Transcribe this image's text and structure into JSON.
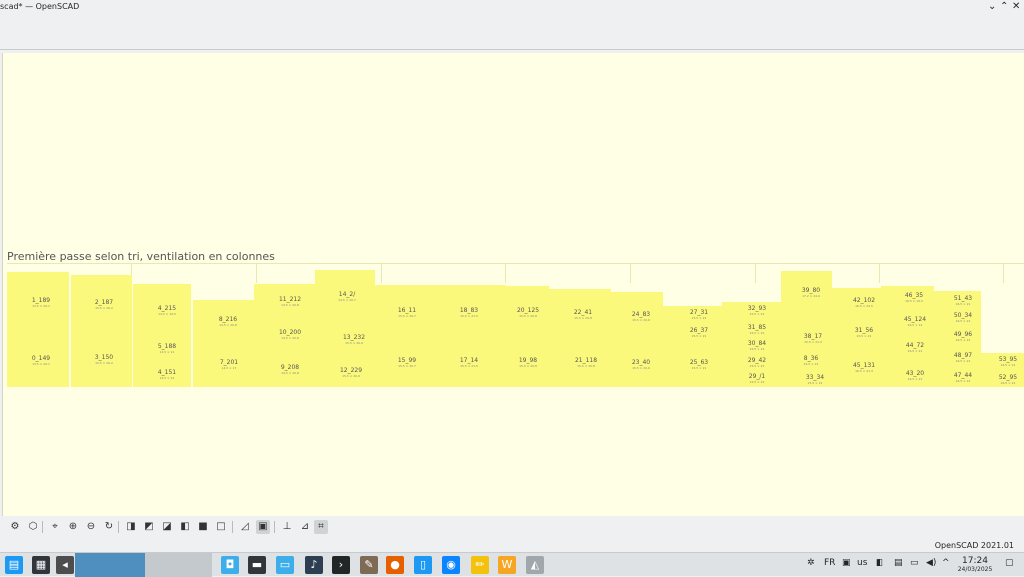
{
  "window": {
    "title": "scad* — OpenSCAD",
    "minimize_icon": "chevron-down-icon",
    "restore_icon": "chevron-up-icon",
    "close_icon": "close-icon"
  },
  "viewport": {
    "background": "#ffffe5",
    "block_color": "#fbf97c",
    "caption": "Première passe selon tri, ventilation en colonnes",
    "labels": [
      {
        "main": "1_189",
        "sub": "13,5 × 20,1"
      },
      {
        "main": "2_187",
        "sub": "15,5 × 20,2"
      },
      {
        "main": "4_215",
        "sub": "14,5 × 16,5"
      },
      {
        "main": "8_216",
        "sub": "14,5 × 20,8"
      },
      {
        "main": "11_212",
        "sub": "14,5 × 20,8"
      },
      {
        "main": "14_2/",
        "sub": "14,5 × 20,7"
      },
      {
        "main": "16_11",
        "sub": "15,5 × 20,7"
      },
      {
        "main": "18_83",
        "sub": "15,5 × 21,5"
      },
      {
        "main": "20_125",
        "sub": "15,5 × 20,8"
      },
      {
        "main": "22_41",
        "sub": "15,5 × 20,8"
      },
      {
        "main": "24_83",
        "sub": "15,5 × 20,6"
      },
      {
        "main": "27_31",
        "sub": "15,5 × 21"
      },
      {
        "main": "32_93",
        "sub": "15,5 × 21"
      },
      {
        "main": "39_80",
        "sub": "17,2 × 24,0"
      },
      {
        "main": "42_102",
        "sub": "16,5 × 24,5"
      },
      {
        "main": "46_35",
        "sub": "16,5 × 19,5"
      },
      {
        "main": "51_43",
        "sub": "16,5 × 21"
      },
      {
        "main": "5_188",
        "sub": "14,5 × 21"
      },
      {
        "main": "10_200",
        "sub": "14,5 × 20,8"
      },
      {
        "main": "13_232",
        "sub": "15,5 × 20,9"
      },
      {
        "main": "26_37",
        "sub": "15,5 × 21"
      },
      {
        "main": "31_85",
        "sub": "15,5 × 21"
      },
      {
        "main": "38_17",
        "sub": "15,5 × 21,3"
      },
      {
        "main": "31_56",
        "sub": "15,5 × 21"
      },
      {
        "main": "45_124",
        "sub": "16,5 × 21"
      },
      {
        "main": "50_34",
        "sub": "16,5 × 21"
      },
      {
        "main": "30_84",
        "sub": "15,5 × 21"
      },
      {
        "main": "44_72",
        "sub": "16,5 × 21"
      },
      {
        "main": "49_96",
        "sub": "16,5 × 21"
      },
      {
        "main": "0_149",
        "sub": "13,5 × 20,1"
      },
      {
        "main": "3_150",
        "sub": "15,5 × 20,2"
      },
      {
        "main": "7_201",
        "sub": "14,5 × 17"
      },
      {
        "main": "4_151",
        "sub": "14,5 × 21"
      },
      {
        "main": "9_208",
        "sub": "14,5 × 20,8"
      },
      {
        "main": "12_229",
        "sub": "15,5 × 20,9"
      },
      {
        "main": "15_99",
        "sub": "15,5 × 20,7"
      },
      {
        "main": "17_14",
        "sub": "15,5 × 21,5"
      },
      {
        "main": "19_98",
        "sub": "15,5 × 20,8"
      },
      {
        "main": "21_118",
        "sub": "15,5 × 20,8"
      },
      {
        "main": "23_40",
        "sub": "15,5 × 20,6"
      },
      {
        "main": "25_63",
        "sub": "15,5 × 21"
      },
      {
        "main": "29_42",
        "sub": "15,5 × 21"
      },
      {
        "main": "29_/1",
        "sub": "15,5 × 21"
      },
      {
        "main": "8_36",
        "sub": "15,5 × 21"
      },
      {
        "main": "33_34",
        "sub": "15,5 × 21"
      },
      {
        "main": "45_131",
        "sub": "16,5 × 21,3"
      },
      {
        "main": "43_20",
        "sub": "16,5 × 21"
      },
      {
        "main": "48_97",
        "sub": "16,5 × 21"
      },
      {
        "main": "47_44",
        "sub": "16,5 × 21"
      },
      {
        "main": "53_95",
        "sub": "16,5 × 21"
      },
      {
        "main": "52_95",
        "sub": "16,5 × 21"
      }
    ]
  },
  "view_toolbar": {
    "buttons": [
      {
        "name": "preview-icon",
        "glyph": "⚙"
      },
      {
        "name": "render-icon",
        "glyph": "⬡"
      },
      {
        "name": "view-all-icon",
        "glyph": "⌖"
      },
      {
        "name": "zoom-in-icon",
        "glyph": "⊕"
      },
      {
        "name": "zoom-out-icon",
        "glyph": "⊖"
      },
      {
        "name": "reset-view-icon",
        "glyph": "↻"
      },
      {
        "name": "view-right-icon",
        "glyph": "◨"
      },
      {
        "name": "view-top-icon",
        "glyph": "◩"
      },
      {
        "name": "view-bottom-icon",
        "glyph": "◪"
      },
      {
        "name": "view-left-icon",
        "glyph": "◧"
      },
      {
        "name": "view-front-icon",
        "glyph": "■"
      },
      {
        "name": "view-back-icon",
        "glyph": "□"
      },
      {
        "name": "perspective-icon",
        "glyph": "◿"
      },
      {
        "name": "orthogonal-icon",
        "glyph": "▣"
      },
      {
        "name": "show-axes-icon",
        "glyph": "⊥"
      },
      {
        "name": "show-scale-icon",
        "glyph": "⊿"
      },
      {
        "name": "show-edges-icon",
        "glyph": "⌗"
      }
    ]
  },
  "statusbar": {
    "version": "OpenSCAD 2021.01"
  },
  "taskbar": {
    "apps": [
      {
        "name": "app-launcher-icon",
        "glyph": "▤",
        "color": "#1d99f3"
      },
      {
        "name": "calculator-icon",
        "glyph": "▦",
        "color": "#31363b"
      },
      {
        "name": "pager-icon",
        "glyph": "◂",
        "color": "#4d4d4d"
      },
      {
        "name": "store-icon",
        "glyph": "◘",
        "color": "#3daee9"
      },
      {
        "name": "terminal-window-icon",
        "glyph": "▬",
        "color": "#31363b"
      },
      {
        "name": "file-manager-icon",
        "glyph": "▭",
        "color": "#3daee9"
      },
      {
        "name": "music-icon",
        "glyph": "♪",
        "color": "#2c3e50"
      },
      {
        "name": "terminal-icon",
        "glyph": "›",
        "color": "#232627"
      },
      {
        "name": "gimp-icon",
        "glyph": "✎",
        "color": "#7f6a55"
      },
      {
        "name": "firefox-icon",
        "glyph": "●",
        "color": "#e66000"
      },
      {
        "name": "document-icon",
        "glyph": "▯",
        "color": "#1d99f3"
      },
      {
        "name": "thunderbird-icon",
        "glyph": "◉",
        "color": "#0a84ff"
      },
      {
        "name": "notes-icon",
        "glyph": "✏",
        "color": "#f4c20d"
      },
      {
        "name": "wps-icon",
        "glyph": "W",
        "color": "#f5a623"
      },
      {
        "name": "openscad-icon",
        "glyph": "◭",
        "color": "#a0a7ad"
      }
    ],
    "tray": {
      "settings_icon": "✲",
      "keyboard_layout": "FR",
      "clipboard_icon": "▣",
      "usb_icon": "▮",
      "locale": "us",
      "battery_icon": "▯",
      "printer_icon": "▤",
      "display_icon": "▭",
      "volume_icon": "◀)",
      "network_icon": "⏻",
      "expand_icon": "^",
      "time": "17:24",
      "date": "24/03/2025",
      "show_desktop_icon": "▢"
    }
  }
}
